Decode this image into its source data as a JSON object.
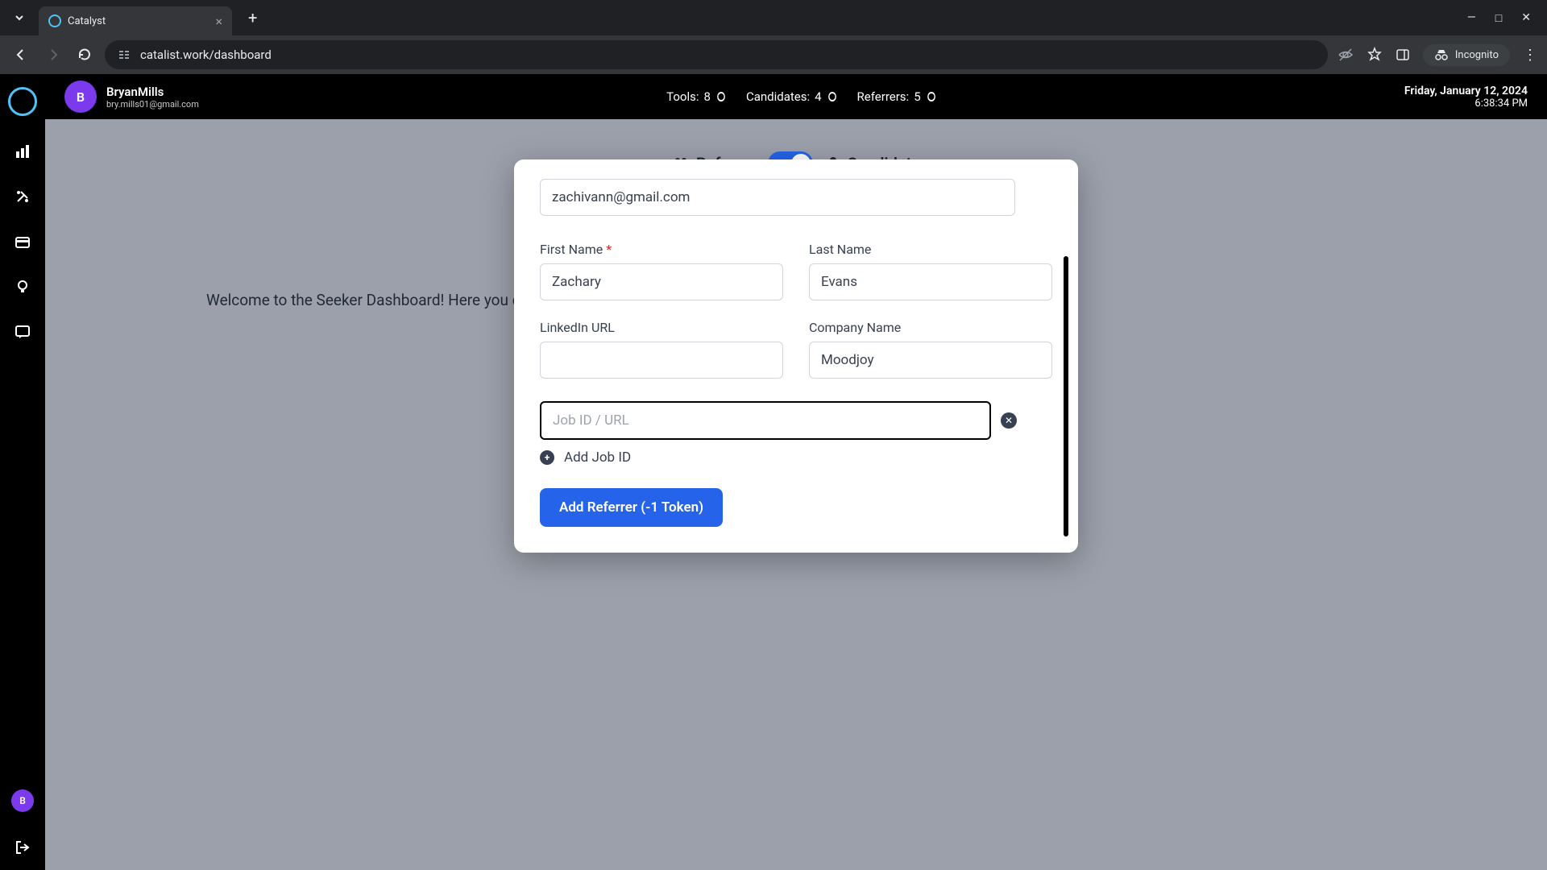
{
  "browser": {
    "tab_title": "Catalyst",
    "url": "catalist.work/dashboard",
    "incognito_label": "Incognito"
  },
  "topbar": {
    "user_initial": "B",
    "user_name": "BryanMills",
    "user_email": "bry.mills01@gmail.com",
    "stats": {
      "tools_label": "Tools:",
      "tools_value": "8",
      "candidates_label": "Candidates:",
      "candidates_value": "4",
      "referrers_label": "Referrers:",
      "referrers_value": "5"
    },
    "date": "Friday, January 12, 2024",
    "time": "6:38:34 PM"
  },
  "sidebar": {
    "avatar_initial": "B"
  },
  "content": {
    "toggle_left": "Referrer",
    "toggle_right": "Candidate",
    "welcome_text": "Welcome to the Seeker Dashboard! Here you can see the referrers you have added and jobs you have requested a referral for."
  },
  "modal": {
    "email_value": "zachivann@gmail.com",
    "first_name_label": "First Name",
    "first_name_value": "Zachary",
    "last_name_label": "Last Name",
    "last_name_value": "Evans",
    "linkedin_label": "LinkedIn URL",
    "linkedin_value": "",
    "company_label": "Company Name",
    "company_value": "Moodjoy",
    "job_placeholder": "Job ID / URL",
    "add_job_label": "Add Job ID",
    "submit_label": "Add Referrer (-1 Token)"
  }
}
